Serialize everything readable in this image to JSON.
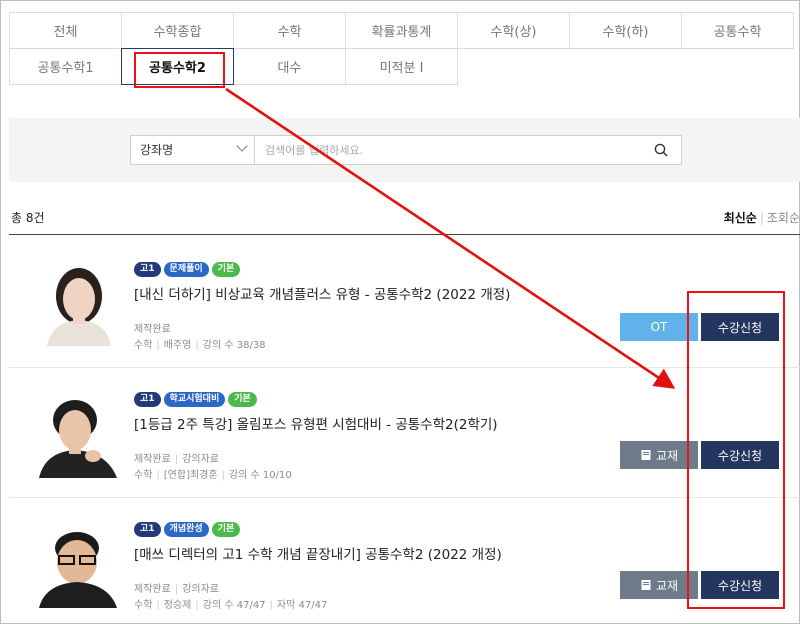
{
  "tabs": {
    "row1": [
      "전체",
      "수학종합",
      "수학",
      "확률과통계",
      "수학(상)",
      "수학(하)",
      "공통수학"
    ],
    "row2": [
      "공통수학1",
      "공통수학2",
      "대수",
      "미적분 I"
    ],
    "active": "공통수학2"
  },
  "search": {
    "select_value": "강좌명",
    "placeholder": "검색어를 입력하세요."
  },
  "count": "총 8건",
  "sort": {
    "latest": "최신순",
    "views": "조회순"
  },
  "courses": [
    {
      "tags": [
        {
          "label": "고1",
          "color": "#233a7a"
        },
        {
          "label": "문제풀이",
          "color": "#2b67c7"
        },
        {
          "label": "기본",
          "color": "#4cb94c"
        }
      ],
      "title": "[내신 더하기] 비상교육 개념플러스 유형 - 공통수학2 (2022 개정)",
      "status": "제작완료",
      "subject": "수학",
      "teacher": "배주영",
      "lectures": "강의 수 38/38",
      "buttons": {
        "ot": "OT",
        "enroll": "수강신청"
      }
    },
    {
      "tags": [
        {
          "label": "고1",
          "color": "#233a7a"
        },
        {
          "label": "학교시험대비",
          "color": "#2b67c7"
        },
        {
          "label": "기본",
          "color": "#4cb94c"
        }
      ],
      "title": "[1등급 2주 특강] 올림포스 유형편 시험대비 - 공통수학2(2학기)",
      "status": "제작완료",
      "material": "강의자료",
      "subject": "수학",
      "teacher": "[연합]최경훈",
      "lectures": "강의 수 10/10",
      "buttons": {
        "book": "교재",
        "enroll": "수강신청"
      }
    },
    {
      "tags": [
        {
          "label": "고1",
          "color": "#233a7a"
        },
        {
          "label": "개념완성",
          "color": "#2b67c7"
        },
        {
          "label": "기본",
          "color": "#4cb94c"
        }
      ],
      "title": "[매쓰 디렉터의 고1 수학 개념 끝장내기] 공통수학2 (2022 개정)",
      "status": "제작완료",
      "material": "강의자료",
      "subject": "수학",
      "teacher": "정승제",
      "lectures": "강의 수 47/47",
      "subtitles": "자막 47/47",
      "buttons": {
        "book": "교재",
        "enroll": "수강신청"
      }
    }
  ],
  "colors": {
    "annotation": "#e11111",
    "enroll": "#243660",
    "ot": "#5fb3ea",
    "book": "#6d7a8a",
    "tag_navy": "#233a7a",
    "tag_blue": "#2b67c7",
    "tag_green": "#4cb94c"
  }
}
